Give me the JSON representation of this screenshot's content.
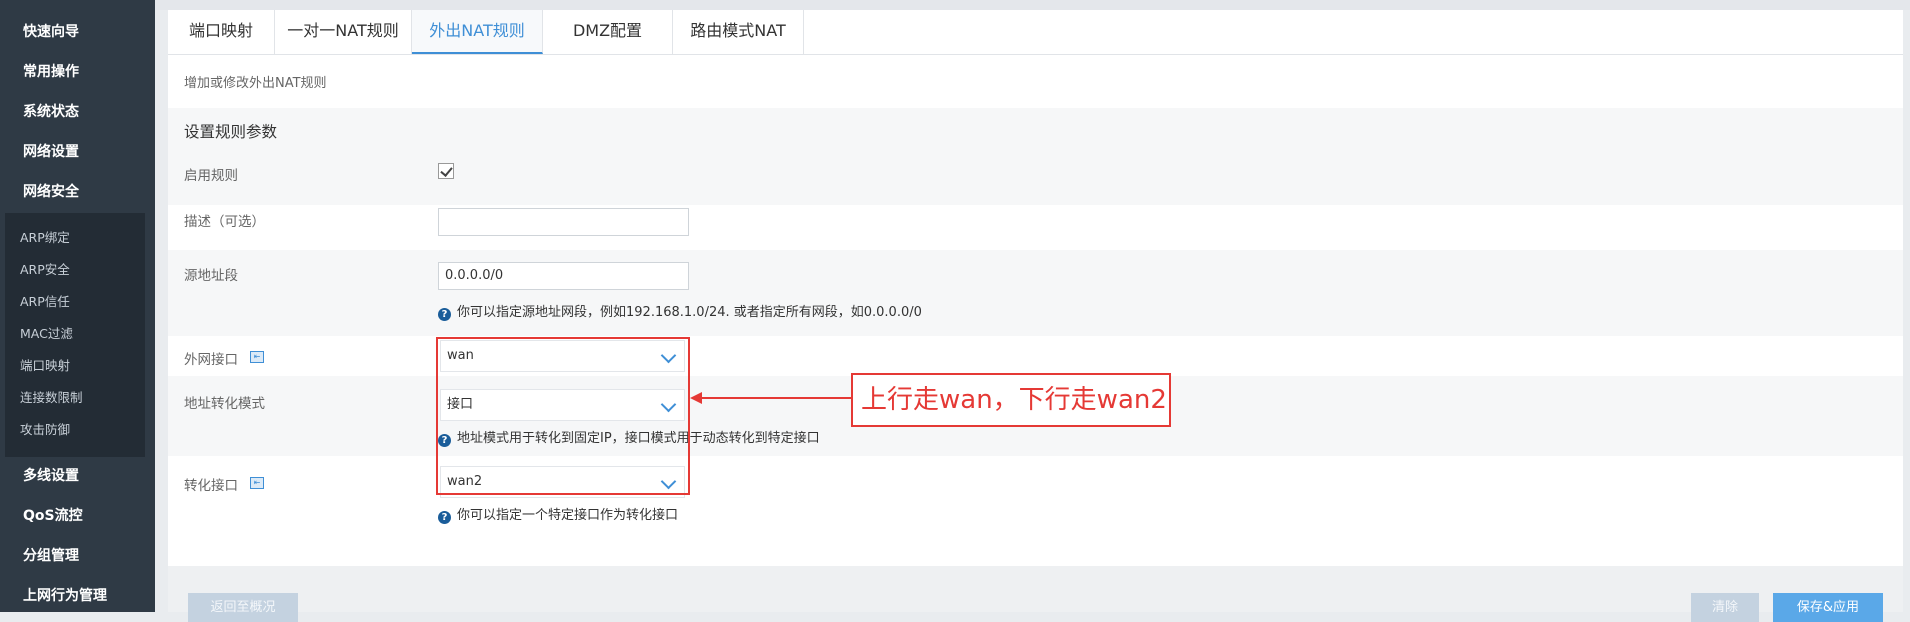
{
  "sidebar": {
    "items": [
      {
        "label": "快速向导"
      },
      {
        "label": "常用操作"
      },
      {
        "label": "系统状态"
      },
      {
        "label": "网络设置"
      },
      {
        "label": "网络安全"
      }
    ],
    "submenu": [
      {
        "label": "ARP绑定"
      },
      {
        "label": "ARP安全"
      },
      {
        "label": "ARP信任"
      },
      {
        "label": "MAC过滤"
      },
      {
        "label": "端口映射"
      },
      {
        "label": "连接数限制"
      },
      {
        "label": "攻击防御"
      }
    ],
    "items_after": [
      {
        "label": "多线设置"
      },
      {
        "label": "QoS流控"
      },
      {
        "label": "分组管理"
      },
      {
        "label": "上网行为管理"
      }
    ]
  },
  "tabs": [
    {
      "label": "端口映射"
    },
    {
      "label": "一对一NAT规则"
    },
    {
      "label": "外出NAT规则"
    },
    {
      "label": "DMZ配置"
    },
    {
      "label": "路由模式NAT"
    }
  ],
  "page": {
    "description": "增加或修改外出NAT规则",
    "section_title": "设置规则参数"
  },
  "form": {
    "enable_label": "启用规则",
    "enable_checked": true,
    "desc_label": "描述（可选）",
    "desc_value": "",
    "src_label": "源地址段",
    "src_value": "0.0.0.0/0",
    "src_hint": "你可以指定源地址网段，例如192.168.1.0/24. 或者指定所有网段，如0.0.0.0/0",
    "wan_label": "外网接口",
    "wan_value": "wan",
    "mode_label": "地址转化模式",
    "mode_value": "接口",
    "mode_hint": "地址模式用于转化到固定IP，接口模式用于动态转化到特定接口",
    "trans_label": "转化接口",
    "trans_value": "wan2",
    "trans_hint": "你可以指定一个特定接口作为转化接口"
  },
  "annotation": {
    "text": "上行走wan，下行走wan2",
    "color": "#e53935"
  },
  "footer": {
    "back_label": "返回至概况",
    "clear_label": "清除",
    "save_label": "保存&应用"
  },
  "colors": {
    "accent": "#3f8fd6",
    "sidebar_bg": "#2f3a45"
  }
}
